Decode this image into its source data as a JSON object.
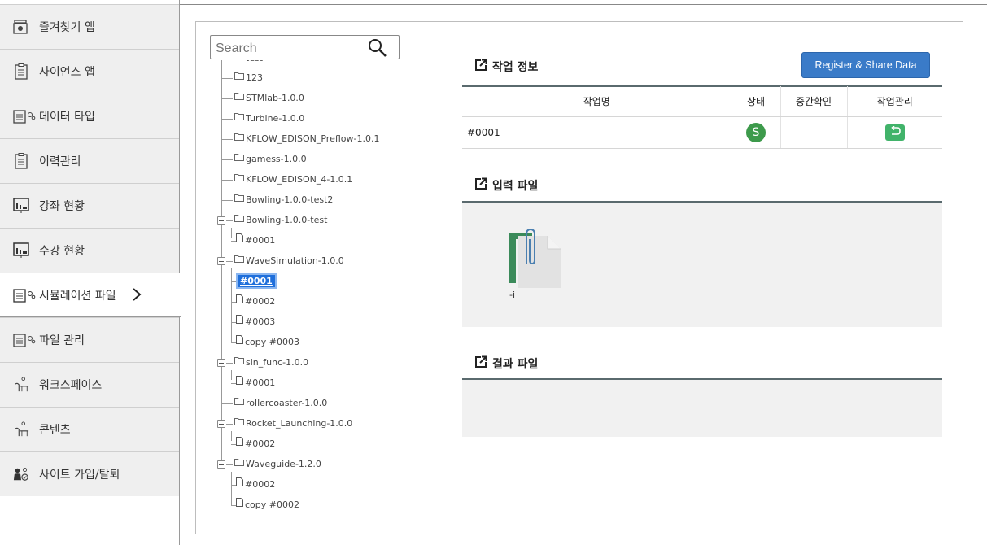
{
  "sidebar": {
    "items": [
      {
        "label": "즐겨찾기 앱"
      },
      {
        "label": "사이언스 앱"
      },
      {
        "label": "데이터 타입"
      },
      {
        "label": "이력관리"
      },
      {
        "label": "강좌 현황"
      },
      {
        "label": "수강 현황"
      },
      {
        "label": "시뮬레이션 파일"
      },
      {
        "label": "파일 관리"
      },
      {
        "label": "워크스페이스"
      },
      {
        "label": "콘텐츠"
      },
      {
        "label": "사이트 가입/탈퇴"
      }
    ]
  },
  "tree": {
    "search_placeholder": "Search",
    "nodes": {
      "n0": "test",
      "n1": "123",
      "n2": "STMlab-1.0.0",
      "n3": "Turbine-1.0.0",
      "n4": "KFLOW_EDISON_Preflow-1.0.1",
      "n5": "gamess-1.0.0",
      "n6": "KFLOW_EDISON_4-1.0.1",
      "n7": "Bowling-1.0.0-test2",
      "n8": "Bowling-1.0.0-test",
      "n9": "#0001",
      "n10": "WaveSimulation-1.0.0",
      "n11": "#0001",
      "n12": "#0002",
      "n13": "#0003",
      "n14": "copy #0003",
      "n15": "sin_func-1.0.0",
      "n16": "#0001",
      "n17": "rollercoaster-1.0.0",
      "n18": "Rocket_Launching-1.0.0",
      "n19": "#0002",
      "n20": "Waveguide-1.2.0",
      "n21": "#0002",
      "n22": "copy #0002"
    }
  },
  "job_info": {
    "title": "작업 정보",
    "register_button": "Register & Share Data",
    "columns": {
      "name": "작업명",
      "status": "상태",
      "check": "중간확인",
      "manage": "작업관리"
    },
    "rows": [
      {
        "name": "#0001",
        "status": "S",
        "check": ""
      }
    ]
  },
  "input_files": {
    "title": "입력 파일",
    "files": [
      {
        "label": "-i"
      }
    ]
  },
  "result_files": {
    "title": "결과 파일"
  },
  "colors": {
    "accent": "#3a7bc8",
    "status_success": "#3d9a4b",
    "manage_button": "#41b36a",
    "tree_selected": "#1f6fdb"
  }
}
